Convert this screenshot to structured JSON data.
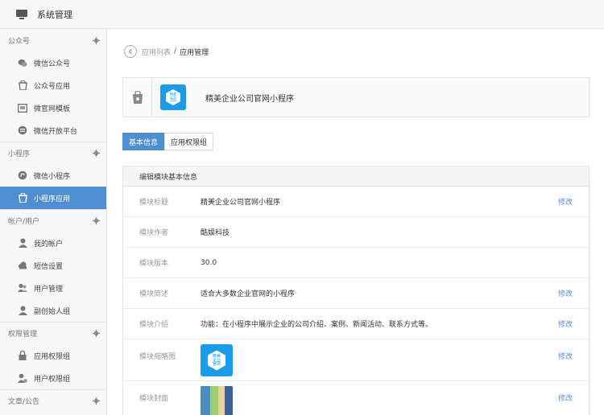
{
  "topbar": {
    "title": "系统管理"
  },
  "sidebar": {
    "groups": [
      {
        "label": "公众号",
        "items": [
          {
            "label": "微信公众号",
            "icon": "wechat-icon"
          },
          {
            "label": "公众号应用",
            "icon": "bag-icon"
          },
          {
            "label": "微官网模板",
            "icon": "template-icon"
          },
          {
            "label": "微信开放平台",
            "icon": "platform-icon"
          }
        ]
      },
      {
        "label": "小程序",
        "items": [
          {
            "label": "微信小程序",
            "icon": "miniprogram-icon"
          },
          {
            "label": "小程序应用",
            "icon": "bag-icon",
            "active": true
          }
        ]
      },
      {
        "label": "帐户/用户",
        "items": [
          {
            "label": "我的帐户",
            "icon": "user-icon"
          },
          {
            "label": "短信设置",
            "icon": "cloud-icon"
          },
          {
            "label": "用户管理",
            "icon": "users-icon"
          },
          {
            "label": "副创始人组",
            "icon": "user-group-icon"
          }
        ]
      },
      {
        "label": "权限管理",
        "items": [
          {
            "label": "应用权限组",
            "icon": "lock-icon"
          },
          {
            "label": "用户权限组",
            "icon": "user-lock-icon"
          }
        ]
      },
      {
        "label": "文章/公告",
        "items": []
      }
    ]
  },
  "breadcrumb": {
    "parent": "应用列表",
    "separator": "/",
    "current": "应用管理"
  },
  "app": {
    "name": "精美企业公司官网小程序",
    "logo_text": [
      "精美",
      "企业",
      "官网"
    ]
  },
  "tabs": [
    {
      "label": "基本信息",
      "active": true
    },
    {
      "label": "应用权限组",
      "active": false
    }
  ],
  "panel": {
    "title": "编辑模块基本信息",
    "edit_label": "修改",
    "rows": [
      {
        "label": "模块标题",
        "value": "精美企业公司官网小程序",
        "editable": true
      },
      {
        "label": "模块作者",
        "value": "酷娱科技",
        "editable": false
      },
      {
        "label": "模块版本",
        "value": "30.0",
        "editable": false
      },
      {
        "label": "模块简述",
        "value": "适合大多数企业官网的小程序",
        "editable": true
      },
      {
        "label": "模块介绍",
        "value": "功能：在小程序中展示企业的公司介绍、案例、新闻活动、联系方式等。",
        "editable": true
      },
      {
        "label": "模块缩略图",
        "value": "",
        "editable": true
      },
      {
        "label": "模块封面",
        "value": "",
        "editable": true
      }
    ]
  },
  "colors": {
    "accent": "#4f8fd1",
    "logo_blue": "#1e9be6"
  }
}
